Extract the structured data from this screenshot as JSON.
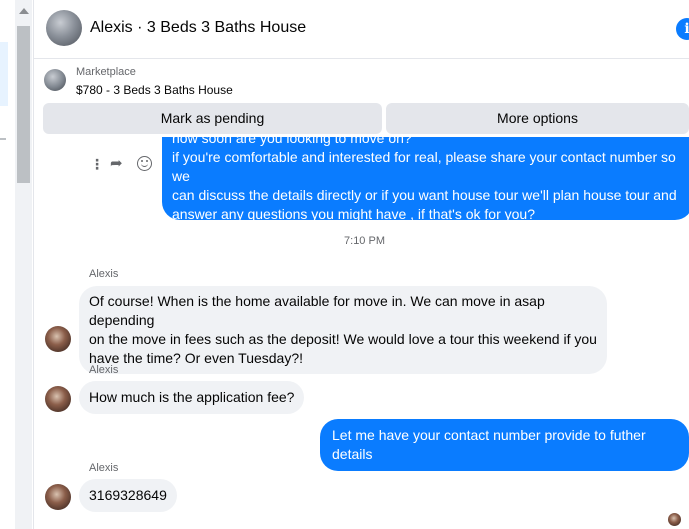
{
  "header": {
    "title": "Alexis · 3 Beds 3 Baths House",
    "info_icon": "info-icon"
  },
  "marketplace": {
    "label": "Marketplace",
    "listing": "$780 - 3 Beds 3 Baths House"
  },
  "actions": {
    "mark_pending": "Mark as pending",
    "more_options": "More options"
  },
  "colors": {
    "outgoing_bubble": "#0a7cff",
    "incoming_bubble": "#f0f2f5",
    "button_bg": "#e4e6eb"
  },
  "messages": [
    {
      "direction": "outgoing",
      "lines": [
        "how soon are you looking to move on?",
        "if you're comfortable and interested for real, please share your contact number so we",
        "can discuss the details directly or if you  want house tour we'll plan house tour and",
        "answer any questions you might have , if that's ok for you?"
      ]
    },
    {
      "timestamp": "7:10 PM"
    },
    {
      "direction": "incoming",
      "sender": "Alexis",
      "lines": [
        "Of course! When is the home available for move in. We can move in asap depending",
        "on the move in fees such as the deposit! We would love a tour this weekend if you",
        "have the time? Or even Tuesday?!"
      ]
    },
    {
      "direction": "incoming",
      "sender": "Alexis",
      "text": "How much is the application fee?"
    },
    {
      "direction": "outgoing",
      "text": "Let me have your contact number provide to futher details"
    },
    {
      "direction": "incoming",
      "sender": "Alexis",
      "text": "3169328649"
    }
  ]
}
